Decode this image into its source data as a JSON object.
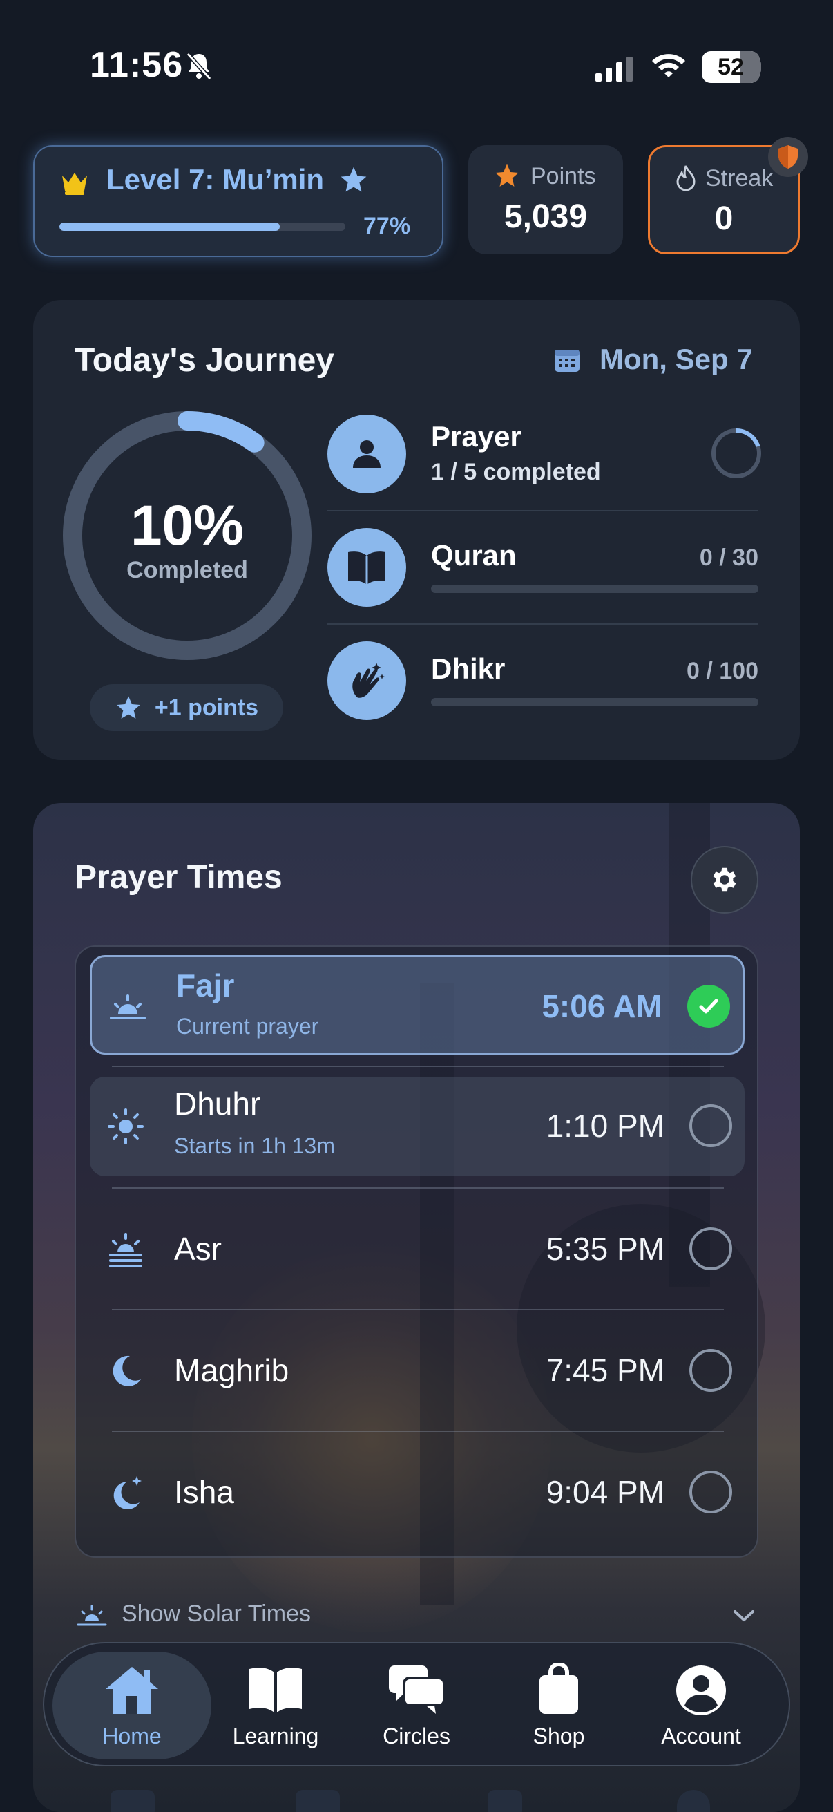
{
  "status_bar": {
    "time": "11:56",
    "battery": "52"
  },
  "level": {
    "title": "Level 7: Mu’min",
    "progress_label": "77%",
    "progress": 0.77
  },
  "points": {
    "label": "Points",
    "value": "5,039"
  },
  "streak": {
    "label": "Streak",
    "value": "0"
  },
  "journey": {
    "title": "Today's Journey",
    "date": "Mon, Sep 7",
    "percent_label": "10%",
    "percent": 0.1,
    "completed_label": "Completed",
    "points_badge": "+1 points",
    "tasks": [
      {
        "name": "Prayer",
        "subtitle": "1 / 5 completed",
        "progress": 0.2
      },
      {
        "name": "Quran",
        "count": "0 / 30",
        "progress": 0
      },
      {
        "name": "Dhikr",
        "count": "0 / 100",
        "progress": 0
      }
    ]
  },
  "prayer_times": {
    "title": "Prayer Times",
    "prayers": [
      {
        "name": "Fajr",
        "subtitle": "Current prayer",
        "time": "5:06 AM",
        "done": true
      },
      {
        "name": "Dhuhr",
        "subtitle": "Starts in 1h 13m",
        "time": "1:10 PM",
        "done": false
      },
      {
        "name": "Asr",
        "time": "5:35 PM",
        "done": false
      },
      {
        "name": "Maghrib",
        "time": "7:45 PM",
        "done": false
      },
      {
        "name": "Isha",
        "time": "9:04 PM",
        "done": false
      }
    ],
    "solar_toggle": "Show Solar Times"
  },
  "tabs": [
    {
      "label": "Home",
      "icon": "home-icon",
      "active": true
    },
    {
      "label": "Learning",
      "icon": "book-icon"
    },
    {
      "label": "Circles",
      "icon": "chat-bubbles-icon"
    },
    {
      "label": "Shop",
      "icon": "shopping-bag-icon"
    },
    {
      "label": "Account",
      "icon": "person-circle-icon"
    }
  ],
  "colors": {
    "accent": "#8fbcf4",
    "streak_border": "#ee7a30",
    "done_green": "#2ecc57",
    "background": "#141a25"
  }
}
